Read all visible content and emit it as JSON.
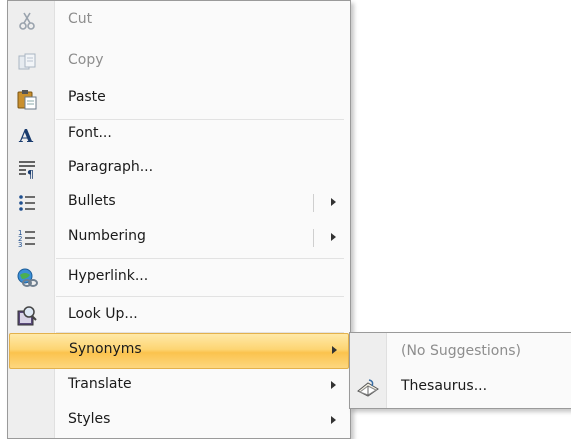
{
  "context_menu": {
    "items": [
      {
        "label": "Cut",
        "icon": "scissors-icon",
        "enabled": false
      },
      {
        "label": "Copy",
        "icon": "copy-icon",
        "enabled": false
      },
      {
        "label": "Paste",
        "icon": "paste-icon",
        "enabled": true
      },
      {
        "label": "Font...",
        "icon": "font-icon",
        "enabled": true
      },
      {
        "label": "Paragraph...",
        "icon": "paragraph-icon",
        "enabled": true
      },
      {
        "label": "Bullets",
        "icon": "bullets-icon",
        "enabled": true,
        "submenu": true
      },
      {
        "label": "Numbering",
        "icon": "numbering-icon",
        "enabled": true,
        "submenu": true
      },
      {
        "label": "Hyperlink...",
        "icon": "hyperlink-icon",
        "enabled": true
      },
      {
        "label": "Look Up...",
        "icon": "lookup-icon",
        "enabled": true
      },
      {
        "label": "Synonyms",
        "enabled": true,
        "submenu": true,
        "highlighted": true
      },
      {
        "label": "Translate",
        "enabled": true,
        "submenu": true
      },
      {
        "label": "Styles",
        "enabled": true,
        "submenu": true
      }
    ]
  },
  "synonyms_submenu": {
    "items": [
      {
        "label": "(No Suggestions)",
        "enabled": false
      },
      {
        "label": "Thesaurus...",
        "icon": "thesaurus-icon",
        "enabled": true
      }
    ]
  },
  "colors": {
    "highlight_top": "#ffe9a8",
    "highlight_bottom": "#fbc34e",
    "highlight_border": "#e3b14c",
    "gutter": "#eeeeee"
  }
}
